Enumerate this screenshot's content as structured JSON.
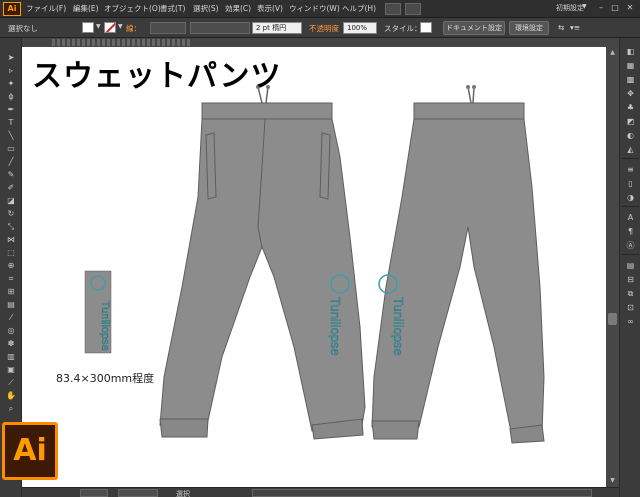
{
  "app": {
    "logo": "Ai",
    "badge": "Ai",
    "workspace": "初期設定",
    "menu": [
      "ファイル(F)",
      "編集(E)",
      "オブジェクト(O)",
      "書式(T)",
      "選択(S)",
      "効果(C)",
      "表示(V)",
      "ウィンドウ(W)",
      "ヘルプ(H)"
    ]
  },
  "control": {
    "selection": "選択なし",
    "stroke_label": "線：",
    "stroke_profile": "2 pt 楕円",
    "opacity_label": "不透明度",
    "opacity_value": "100%",
    "style_label": "スタイル：",
    "doc_setup": "ドキュメント設定",
    "prefs": "環境設定"
  },
  "document": {
    "title": "スウェットパンツ",
    "caption": "83.4×300mm程度",
    "print_text": "Tuniliopse",
    "colors": {
      "pants_fill": "#8c8c8c",
      "pants_stroke": "#5e5e5e",
      "print_color": "#3a9fb0"
    }
  },
  "status": {
    "mode": "選択"
  },
  "icons": {
    "tools": [
      "selection-tool-icon",
      "direct-selection-tool-icon",
      "magic-wand-icon",
      "lasso-icon",
      "pen-icon",
      "type-icon",
      "line-icon",
      "rectangle-icon",
      "paintbrush-icon",
      "pencil-icon",
      "blob-brush-icon",
      "eraser-icon",
      "rotate-icon",
      "scale-icon",
      "width-icon",
      "free-transform-icon",
      "shape-builder-icon",
      "perspective-grid-icon",
      "mesh-icon",
      "gradient-icon",
      "eyedropper-icon",
      "blend-icon",
      "symbol-sprayer-icon",
      "column-graph-icon",
      "artboard-icon",
      "slice-icon",
      "hand-icon",
      "zoom-icon"
    ]
  }
}
